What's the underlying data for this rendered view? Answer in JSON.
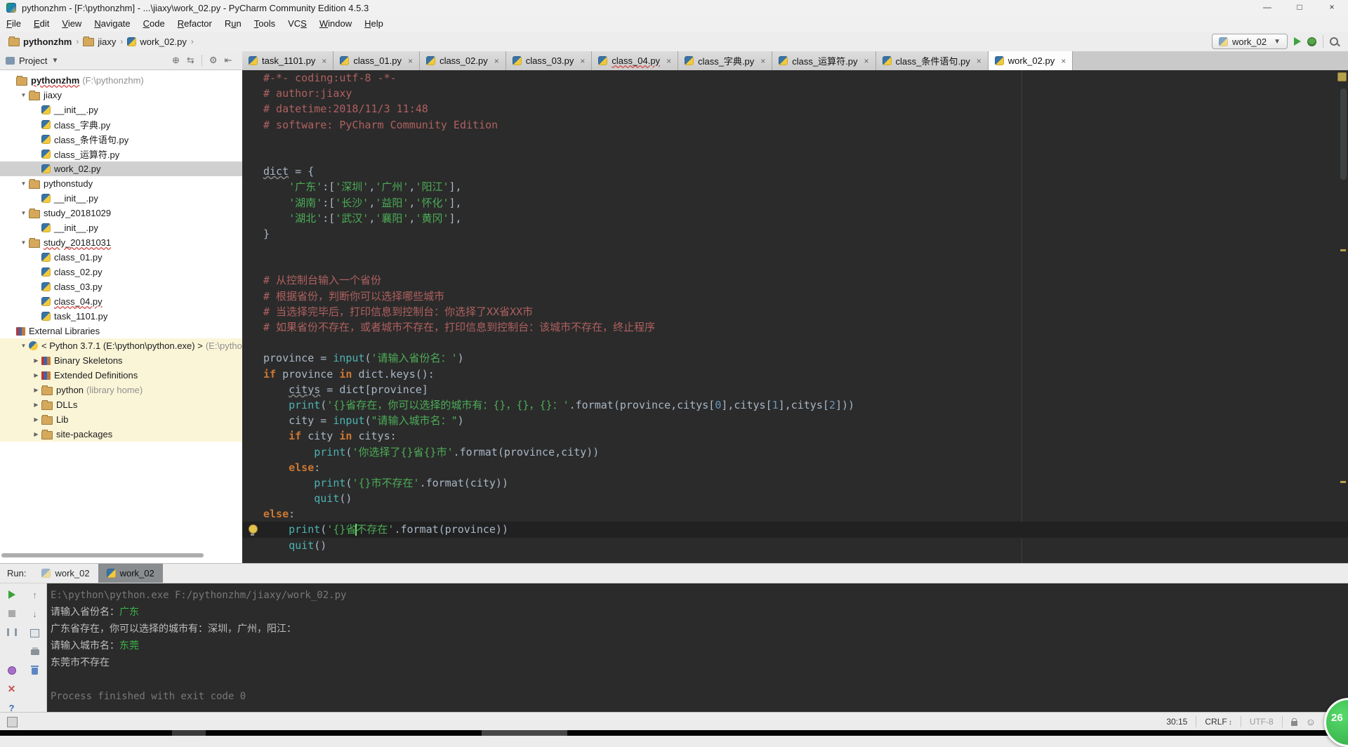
{
  "colors": {
    "editor_bg": "#2B2B2B",
    "comment": "#B06060",
    "string": "#4CAC57",
    "keyword": "#CC7832",
    "function_call": "#4DB3B3",
    "identifier": "#A9B7C6",
    "number": "#6897BB",
    "console_input_green": "#3CB44A",
    "chrome_gray": "#ECECEC",
    "selection_gray": "#D0D0D0",
    "library_cream": "#FBF5D8",
    "current_line": "#212121"
  },
  "title_bar": {
    "title": "pythonzhm - [F:\\pythonzhm] - ...\\jiaxy\\work_02.py - PyCharm Community Edition 4.5.3",
    "buttons": [
      {
        "name": "minimize",
        "glyph": "—"
      },
      {
        "name": "maximize",
        "glyph": "□"
      },
      {
        "name": "close",
        "glyph": "×"
      }
    ]
  },
  "menu": {
    "items": [
      {
        "label": "File",
        "u": 0
      },
      {
        "label": "Edit",
        "u": 0
      },
      {
        "label": "View",
        "u": 0
      },
      {
        "label": "Navigate",
        "u": 0
      },
      {
        "label": "Code",
        "u": 0
      },
      {
        "label": "Refactor",
        "u": 0
      },
      {
        "label": "Run",
        "u": 1
      },
      {
        "label": "Tools",
        "u": 0
      },
      {
        "label": "VCS",
        "u": 2
      },
      {
        "label": "Window",
        "u": 0
      },
      {
        "label": "Help",
        "u": 0
      }
    ]
  },
  "breadcrumb": {
    "items": [
      {
        "label": "pythonzhm",
        "icon": "folder"
      },
      {
        "label": "jiaxy",
        "icon": "folder"
      },
      {
        "label": "work_02.py",
        "icon": "py"
      }
    ]
  },
  "run_widget": {
    "config": "work_02"
  },
  "project": {
    "header": "Project",
    "tools": [
      "scroll-from-source",
      "compare",
      "divider",
      "settings",
      "hide"
    ],
    "tree": [
      {
        "l": 0,
        "a": null,
        "i": "folder",
        "t": "pythonzhm",
        "s": " (F:\\pythonzhm)",
        "b": true,
        "w": true
      },
      {
        "l": 1,
        "a": "o",
        "i": "folder",
        "t": "jiaxy"
      },
      {
        "l": 2,
        "a": null,
        "i": "py",
        "t": "__init__.py"
      },
      {
        "l": 2,
        "a": null,
        "i": "py",
        "t": "class_字典.py"
      },
      {
        "l": 2,
        "a": null,
        "i": "py",
        "t": "class_条件语句.py"
      },
      {
        "l": 2,
        "a": null,
        "i": "py",
        "t": "class_运算符.py"
      },
      {
        "l": 2,
        "a": null,
        "i": "py",
        "t": "work_02.py",
        "sel": true
      },
      {
        "l": 1,
        "a": "o",
        "i": "folder",
        "t": "pythonstudy"
      },
      {
        "l": 2,
        "a": null,
        "i": "py",
        "t": "__init__.py"
      },
      {
        "l": 1,
        "a": "o",
        "i": "folder",
        "t": "study_20181029"
      },
      {
        "l": 2,
        "a": null,
        "i": "py",
        "t": "__init__.py"
      },
      {
        "l": 1,
        "a": "o",
        "i": "folder",
        "t": "study_20181031",
        "w": true
      },
      {
        "l": 2,
        "a": null,
        "i": "py",
        "t": "class_01.py"
      },
      {
        "l": 2,
        "a": null,
        "i": "py",
        "t": "class_02.py"
      },
      {
        "l": 2,
        "a": null,
        "i": "py",
        "t": "class_03.py"
      },
      {
        "l": 2,
        "a": null,
        "i": "py",
        "t": "class_04.py",
        "w": true
      },
      {
        "l": 2,
        "a": null,
        "i": "py",
        "t": "task_1101.py"
      },
      {
        "l": 0,
        "a": null,
        "i": "lib",
        "t": "External Libraries"
      },
      {
        "l": 1,
        "a": "o",
        "i": "python",
        "t": "< Python 3.7.1 (E:\\python\\python.exe) >",
        "s": " (E:\\python\\p",
        "cream": true
      },
      {
        "l": 2,
        "a": "c",
        "i": "lib",
        "t": "Binary Skeletons",
        "cream": true
      },
      {
        "l": 2,
        "a": "c",
        "i": "lib",
        "t": "Extended Definitions",
        "cream": true
      },
      {
        "l": 2,
        "a": "c",
        "i": "folder",
        "t": "python",
        "s": " (library home)",
        "cream": true
      },
      {
        "l": 2,
        "a": "c",
        "i": "folder",
        "t": "DLLs",
        "cream": true
      },
      {
        "l": 2,
        "a": "c",
        "i": "folder",
        "t": "Lib",
        "cream": true
      },
      {
        "l": 2,
        "a": "c",
        "i": "folder",
        "t": "site-packages",
        "cream": true
      }
    ]
  },
  "editor_tabs": [
    {
      "label": "task_1101.py"
    },
    {
      "label": "class_01.py"
    },
    {
      "label": "class_02.py"
    },
    {
      "label": "class_03.py"
    },
    {
      "label": "class_04.py",
      "w": true
    },
    {
      "label": "class_字典.py"
    },
    {
      "label": "class_运算符.py"
    },
    {
      "label": "class_条件语句.py"
    },
    {
      "label": "work_02.py",
      "active": true
    }
  ],
  "editor": {
    "current_line": 29,
    "lines": [
      [
        {
          "t": "#-*- coding:utf-8 -*-",
          "c": "cm"
        }
      ],
      [
        {
          "t": "# author:jiaxy",
          "c": "cm"
        }
      ],
      [
        {
          "t": "# datetime:2018/11/3 11:48",
          "c": "cm"
        }
      ],
      [
        {
          "t": "# software: PyCharm Community Edition",
          "c": "cm"
        }
      ],
      [],
      [],
      [
        {
          "t": "dict",
          "wv": true
        },
        {
          "t": " = {"
        }
      ],
      [
        {
          "t": "    "
        },
        {
          "t": "'广东'",
          "c": "st"
        },
        {
          "t": ":["
        },
        {
          "t": "'深圳'",
          "c": "st"
        },
        {
          "t": ","
        },
        {
          "t": "'广州'",
          "c": "st"
        },
        {
          "t": ","
        },
        {
          "t": "'阳江'",
          "c": "st"
        },
        {
          "t": "],"
        }
      ],
      [
        {
          "t": "    "
        },
        {
          "t": "'湖南'",
          "c": "st"
        },
        {
          "t": ":["
        },
        {
          "t": "'长沙'",
          "c": "st"
        },
        {
          "t": ","
        },
        {
          "t": "'益阳'",
          "c": "st"
        },
        {
          "t": ","
        },
        {
          "t": "'怀化'",
          "c": "st"
        },
        {
          "t": "],"
        }
      ],
      [
        {
          "t": "    "
        },
        {
          "t": "'湖北'",
          "c": "st"
        },
        {
          "t": ":["
        },
        {
          "t": "'武汉'",
          "c": "st"
        },
        {
          "t": ","
        },
        {
          "t": "'襄阳'",
          "c": "st"
        },
        {
          "t": ","
        },
        {
          "t": "'黄冈'",
          "c": "st"
        },
        {
          "t": "],"
        }
      ],
      [
        {
          "t": "}"
        }
      ],
      [],
      [],
      [
        {
          "t": "# 从控制台输入一个省份",
          "c": "cm"
        }
      ],
      [
        {
          "t": "# 根据省份，判断你可以选择哪些城市",
          "c": "cm"
        }
      ],
      [
        {
          "t": "# 当选择完毕后，打印信息到控制台：你选择了XX省XX市",
          "c": "cm"
        }
      ],
      [
        {
          "t": "# 如果省份不存在，或者城市不存在，打印信息到控制台：该城市不存在，终止程序",
          "c": "cm"
        }
      ],
      [],
      [
        {
          "t": "province = "
        },
        {
          "t": "input",
          "c": "fn"
        },
        {
          "t": "("
        },
        {
          "t": "'请输入省份名：'",
          "c": "st"
        },
        {
          "t": ")"
        }
      ],
      [
        {
          "t": "if ",
          "c": "kw"
        },
        {
          "t": "province "
        },
        {
          "t": "in ",
          "c": "kw"
        },
        {
          "t": "dict.keys():"
        }
      ],
      [
        {
          "t": "    "
        },
        {
          "t": "citys",
          "wv": true
        },
        {
          "t": " = dict[province]"
        }
      ],
      [
        {
          "t": "    "
        },
        {
          "t": "print",
          "c": "fn"
        },
        {
          "t": "("
        },
        {
          "t": "'{}省存在，你可以选择的城市有：{}，{}，{}：'",
          "c": "st"
        },
        {
          "t": ".format(province,citys["
        },
        {
          "t": "0",
          "c": "nu"
        },
        {
          "t": "],citys["
        },
        {
          "t": "1",
          "c": "nu"
        },
        {
          "t": "],citys["
        },
        {
          "t": "2",
          "c": "nu"
        },
        {
          "t": "]))"
        }
      ],
      [
        {
          "t": "    "
        },
        {
          "t": "city = "
        },
        {
          "t": "input",
          "c": "fn"
        },
        {
          "t": "("
        },
        {
          "t": "\"请输入城市名：\"",
          "c": "st"
        },
        {
          "t": ")"
        }
      ],
      [
        {
          "t": "    "
        },
        {
          "t": "if ",
          "c": "kw"
        },
        {
          "t": "city "
        },
        {
          "t": "in ",
          "c": "kw"
        },
        {
          "t": "citys:"
        }
      ],
      [
        {
          "t": "        "
        },
        {
          "t": "print",
          "c": "fn"
        },
        {
          "t": "("
        },
        {
          "t": "'你选择了{}省{}市'",
          "c": "st"
        },
        {
          "t": ".format(province,city))"
        }
      ],
      [
        {
          "t": "    "
        },
        {
          "t": "else",
          "c": "kw"
        },
        {
          "t": ":"
        }
      ],
      [
        {
          "t": "        "
        },
        {
          "t": "print",
          "c": "fn"
        },
        {
          "t": "("
        },
        {
          "t": "'{}市不存在'",
          "c": "st"
        },
        {
          "t": ".format(city))"
        }
      ],
      [
        {
          "t": "        "
        },
        {
          "t": "quit",
          "c": "fn"
        },
        {
          "t": "()"
        }
      ],
      [
        {
          "t": "else",
          "c": "kw"
        },
        {
          "t": ":"
        }
      ],
      [
        {
          "t": "    "
        },
        {
          "t": "print",
          "c": "fn"
        },
        {
          "t": "("
        },
        {
          "t": "'{}省",
          "c": "st"
        },
        {
          "caret": true
        },
        {
          "t": "不存在'",
          "c": "st"
        },
        {
          "t": ".format(province))"
        }
      ],
      [
        {
          "t": "    "
        },
        {
          "t": "quit",
          "c": "fn"
        },
        {
          "t": "()"
        }
      ]
    ]
  },
  "run_panel": {
    "label": "Run:",
    "tabs": [
      {
        "label": "work_02",
        "active": false
      },
      {
        "label": "work_02",
        "active": true
      }
    ],
    "console": [
      [
        {
          "t": "E:\\python\\python.exe F:/pythonzhm/jiaxy/work_02.py",
          "c": "sys"
        }
      ],
      [
        {
          "t": "请输入省份名：",
          "c": "out"
        },
        {
          "t": "广东",
          "c": "usr"
        }
      ],
      [
        {
          "t": "广东省存在，你可以选择的城市有：深圳，广州，阳江：",
          "c": "out"
        }
      ],
      [
        {
          "t": "请输入城市名：",
          "c": "out"
        },
        {
          "t": "东莞",
          "c": "usr"
        }
      ],
      [
        {
          "t": "东莞市不存在",
          "c": "out"
        }
      ],
      [],
      [
        {
          "t": "Process finished with exit code 0",
          "c": "sys"
        }
      ]
    ]
  },
  "status_bar": {
    "position": "30:15",
    "line_ending": "CRLF",
    "encoding": "UTF-8"
  },
  "overlay": {
    "badge": "26"
  }
}
